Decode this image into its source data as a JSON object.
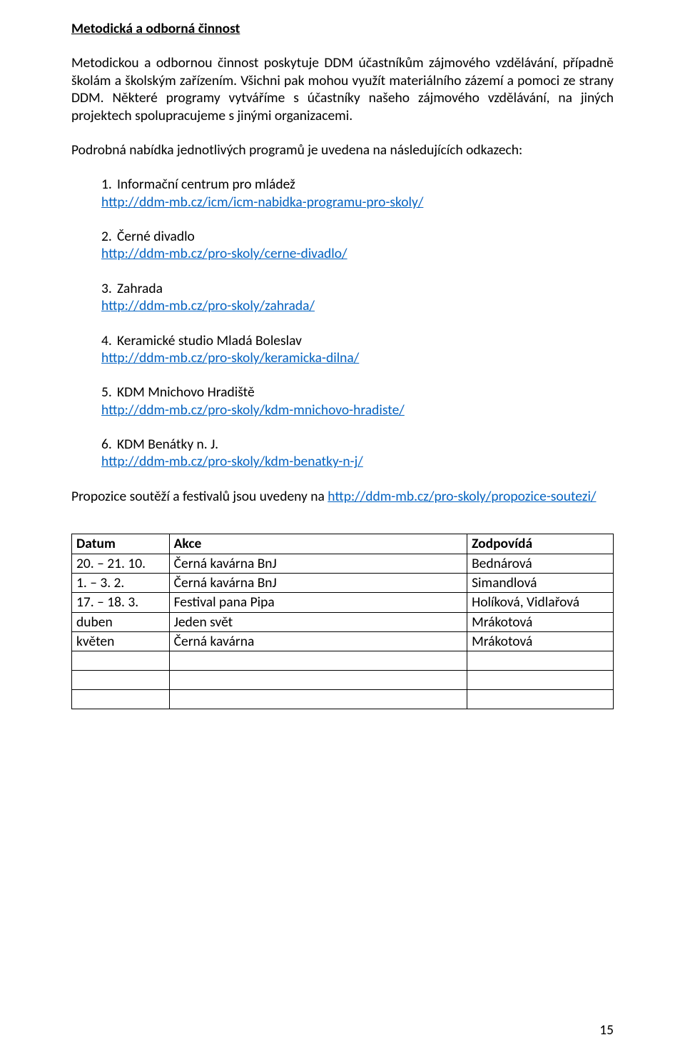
{
  "heading": "Metodická a odborná činnost",
  "intro": "Metodickou a odbornou činnost poskytuje DDM účastníkům zájmového vzdělávání, případně školám a školským zařízením. Všichni pak mohou využít materiálního zázemí a pomoci ze strany DDM. Některé programy vytváříme s účastníky našeho zájmového vzdělávání, na jiných projektech spolupracujeme s jinými organizacemi.",
  "offers_line": "Podrobná nabídka jednotlivých programů je uvedena na následujících odkazech:",
  "programs": [
    {
      "num": "1.",
      "title": "Informační centrum pro mládež",
      "url": "http://ddm-mb.cz/icm/icm-nabidka-programu-pro-skoly/"
    },
    {
      "num": "2.",
      "title": "Černé divadlo",
      "url": "http://ddm-mb.cz/pro-skoly/cerne-divadlo/"
    },
    {
      "num": "3.",
      "title": "Zahrada",
      "url": "http://ddm-mb.cz/pro-skoly/zahrada/"
    },
    {
      "num": "4.",
      "title": "Keramické studio Mladá Boleslav",
      "url": "http://ddm-mb.cz/pro-skoly/keramicka-dilna/"
    },
    {
      "num": "5.",
      "title": "KDM Mnichovo Hradiště",
      "url": "http://ddm-mb.cz/pro-skoly/kdm-mnichovo-hradiste/"
    },
    {
      "num": "6.",
      "title": "KDM Benátky n. J.",
      "url": "http://ddm-mb.cz/pro-skoly/kdm-benatky-n-j/"
    }
  ],
  "propozice": {
    "before": "Propozice soutěží a festivalů jsou uvedeny na ",
    "url": "http://ddm-mb.cz/pro-skoly/propozice-soutezi/"
  },
  "table": {
    "headers": {
      "datum": "Datum",
      "akce": "Akce",
      "zodpovida": "Zodpovídá"
    },
    "rows": [
      {
        "datum": "20. – 21. 10.",
        "akce": "Černá kavárna BnJ",
        "zodp": "Bednárová"
      },
      {
        "datum": "1. – 3. 2.",
        "akce": "Černá kavárna BnJ",
        "zodp": "Simandlová"
      },
      {
        "datum": "17. – 18. 3.",
        "akce": "Festival pana Pipa",
        "zodp": "Holíková, Vidlařová"
      },
      {
        "datum": "duben",
        "akce": "Jeden svět",
        "zodp": "Mrákotová"
      },
      {
        "datum": "květen",
        "akce": "Černá kavárna",
        "zodp": "Mrákotová"
      },
      {
        "datum": "",
        "akce": "",
        "zodp": ""
      },
      {
        "datum": "",
        "akce": "",
        "zodp": ""
      },
      {
        "datum": "",
        "akce": "",
        "zodp": ""
      }
    ]
  },
  "page_number": "15"
}
